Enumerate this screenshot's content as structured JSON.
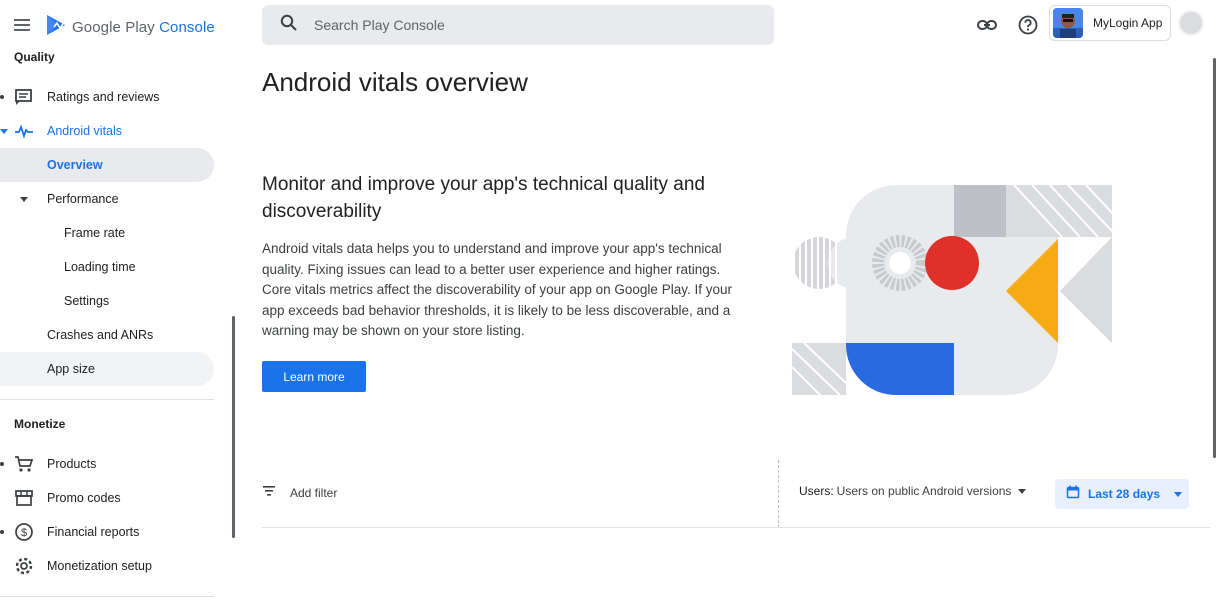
{
  "header": {
    "logo_text_1": "Google Play",
    "logo_text_2": "Console",
    "search_placeholder": "Search Play Console",
    "app_name": "MyLogin App"
  },
  "sidebar": {
    "section_quality": "Quality",
    "items": [
      {
        "label": "Ratings and reviews",
        "icon": "ratings-icon"
      },
      {
        "label": "Android vitals",
        "icon": "vitals-icon"
      },
      {
        "label": "Overview"
      },
      {
        "label": "Performance"
      },
      {
        "label": "Frame rate"
      },
      {
        "label": "Loading time"
      },
      {
        "label": "Settings"
      },
      {
        "label": "Crashes and ANRs"
      },
      {
        "label": "App size"
      }
    ],
    "section_monetize": "Monetize",
    "monetize_items": [
      {
        "label": "Products",
        "icon": "cart-icon"
      },
      {
        "label": "Promo codes",
        "icon": "store-icon"
      },
      {
        "label": "Financial reports",
        "icon": "dollar-icon"
      },
      {
        "label": "Monetization setup",
        "icon": "gear-icon"
      }
    ]
  },
  "main": {
    "title": "Android vitals overview",
    "headline": "Monitor and improve your app's technical quality and discoverability",
    "description": "Android vitals data helps you to understand and improve your app's technical quality. Fixing issues can lead to a better user experience and higher ratings. Core vitals metrics affect the discoverability of your app on Google Play. If your app exceeds bad behavior thresholds, it is likely to be less discoverable, and a warning may be shown on your store listing.",
    "learn_more": "Learn more",
    "add_filter": "Add filter",
    "users_label": "Users:",
    "users_value": "Users on public Android versions",
    "date_range": "Last 28 days"
  },
  "colors": {
    "accent": "#1a73e8",
    "illus_red": "#e0302a",
    "illus_yellow": "#f6ab14",
    "illus_blue": "#2a6ae0",
    "illus_gray": "#e8eaed"
  }
}
